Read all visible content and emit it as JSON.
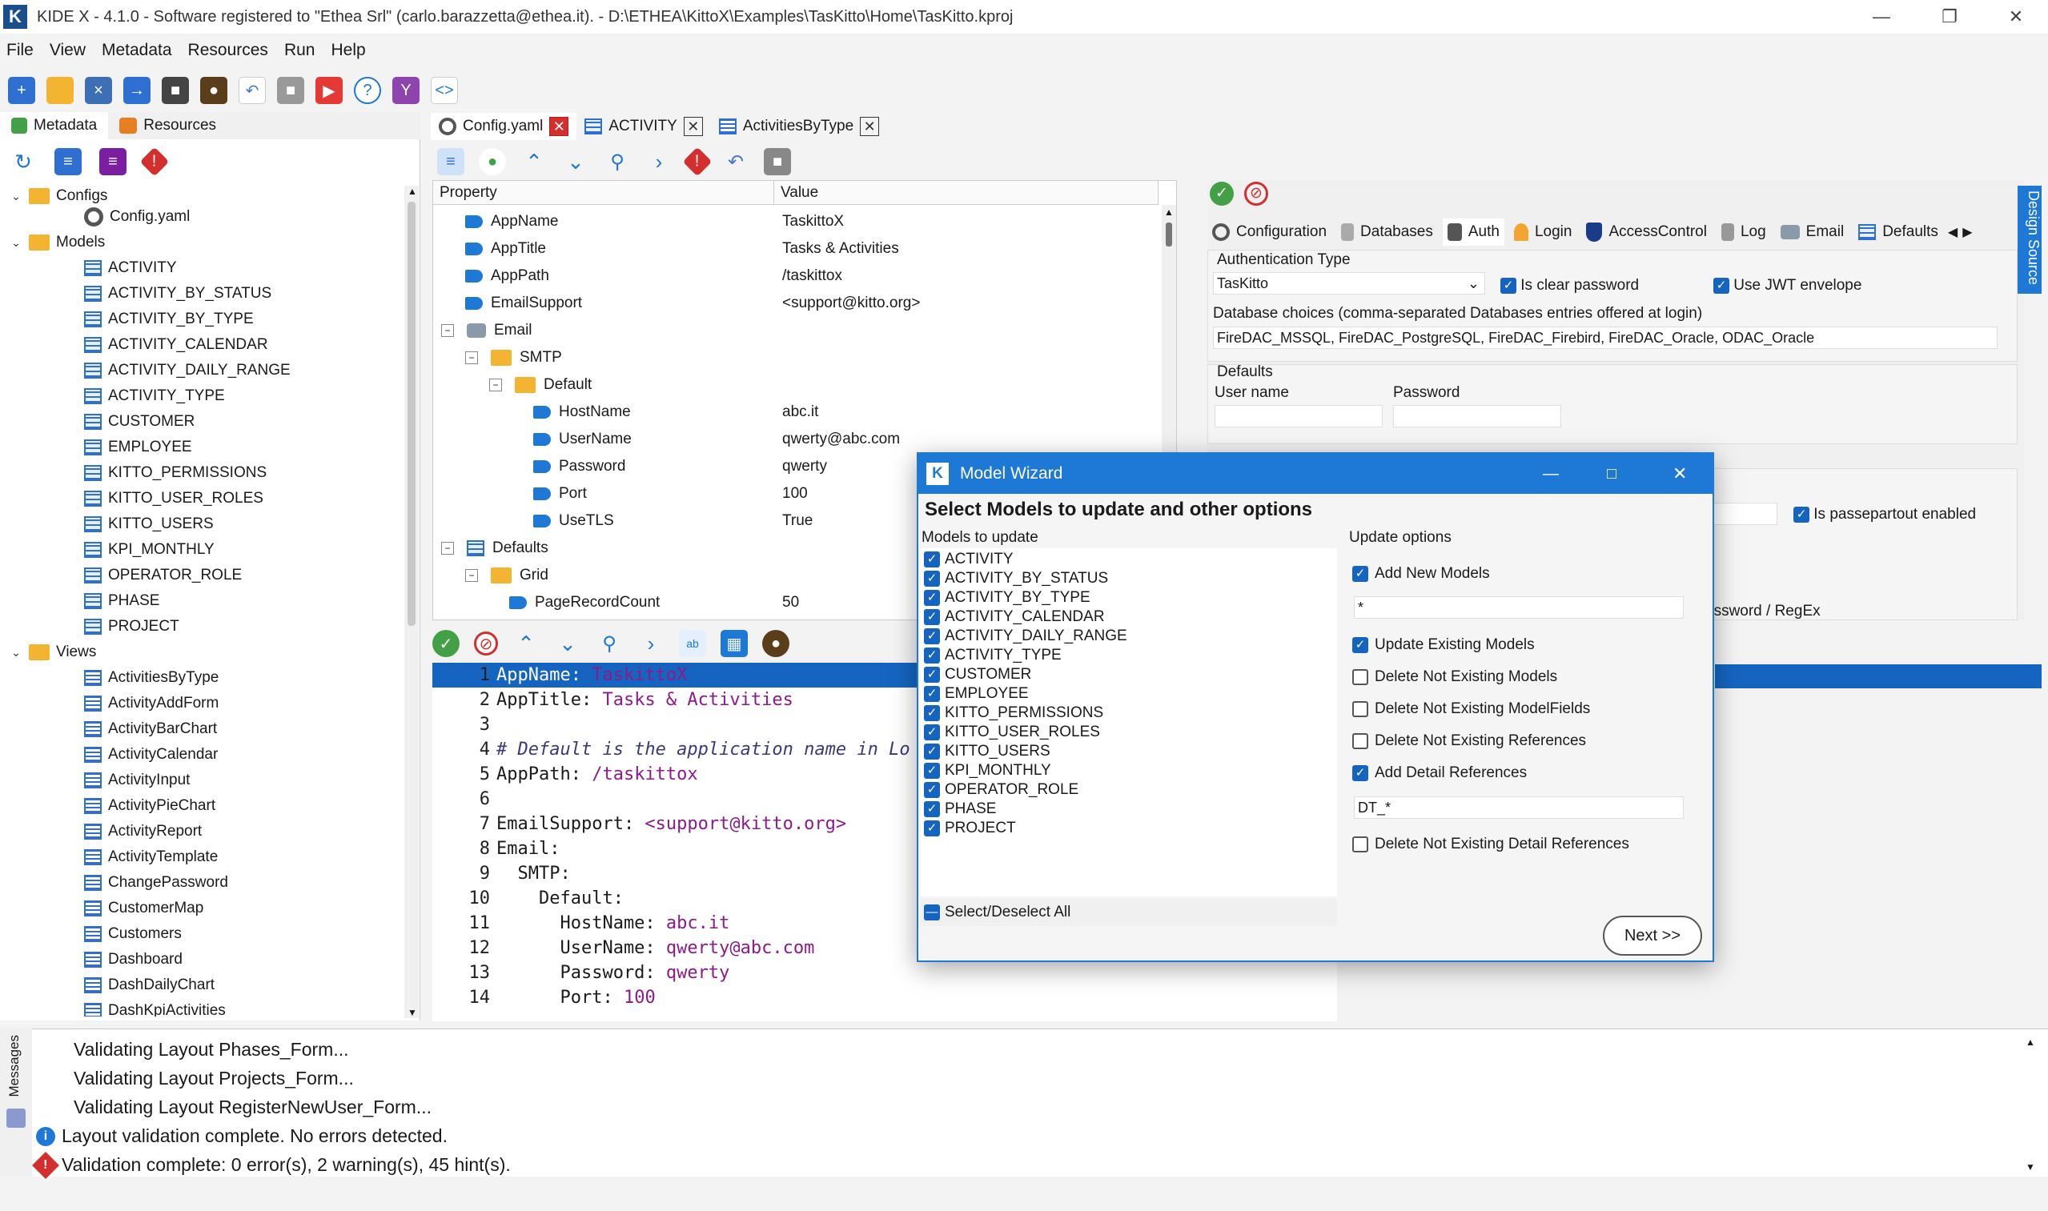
{
  "window": {
    "title": "KIDE X - 4.1.0 - Software registered to \"Ethea Srl\" (carlo.barazzetta@ethea.it). - D:\\ETHEA\\KittoX\\Examples\\TasKitto\\Home\\TasKitto.kproj",
    "logo": "K"
  },
  "menu": [
    "File",
    "View",
    "Metadata",
    "Resources",
    "Run",
    "Help"
  ],
  "left_tabs": {
    "metadata": "Metadata",
    "resources": "Resources"
  },
  "tree": {
    "configs_label": "Configs",
    "config_file": "Config.yaml",
    "models_label": "Models",
    "models": [
      "ACTIVITY",
      "ACTIVITY_BY_STATUS",
      "ACTIVITY_BY_TYPE",
      "ACTIVITY_CALENDAR",
      "ACTIVITY_DAILY_RANGE",
      "ACTIVITY_TYPE",
      "CUSTOMER",
      "EMPLOYEE",
      "KITTO_PERMISSIONS",
      "KITTO_USER_ROLES",
      "KITTO_USERS",
      "KPI_MONTHLY",
      "OPERATOR_ROLE",
      "PHASE",
      "PROJECT"
    ],
    "views_label": "Views",
    "views": [
      "ActivitiesByType",
      "ActivityAddForm",
      "ActivityBarChart",
      "ActivityCalendar",
      "ActivityInput",
      "ActivityPieChart",
      "ActivityReport",
      "ActivityTemplate",
      "ChangePassword",
      "CustomerMap",
      "Customers",
      "Dashboard",
      "DashDailyChart",
      "DashKpiActivities"
    ]
  },
  "doc_tabs": [
    "Config.yaml",
    "ACTIVITY",
    "ActivitiesByType"
  ],
  "propgrid": {
    "col_property": "Property",
    "col_value": "Value",
    "rows": [
      {
        "name": "AppName",
        "value": "TaskittoX"
      },
      {
        "name": "AppTitle",
        "value": "Tasks & Activities"
      },
      {
        "name": "AppPath",
        "value": "/taskittox"
      },
      {
        "name": "EmailSupport",
        "value": "<support@kitto.org>"
      },
      {
        "name": "Email",
        "value": ""
      },
      {
        "name": "SMTP",
        "value": ""
      },
      {
        "name": "Default",
        "value": ""
      },
      {
        "name": "HostName",
        "value": "abc.it"
      },
      {
        "name": "UserName",
        "value": "qwerty@abc.com"
      },
      {
        "name": "Password",
        "value": "qwerty"
      },
      {
        "name": "Port",
        "value": "100"
      },
      {
        "name": "UseTLS",
        "value": "True"
      },
      {
        "name": "Defaults",
        "value": ""
      },
      {
        "name": "Grid",
        "value": ""
      },
      {
        "name": "PageRecordCount",
        "value": "50"
      }
    ]
  },
  "editor": {
    "lines": [
      {
        "n": "1",
        "k": "AppName:",
        "v": " TaskittoX",
        "c": ""
      },
      {
        "n": "2",
        "k": "AppTitle:",
        "v": " Tasks & Activities",
        "c": ""
      },
      {
        "n": "3",
        "k": "",
        "v": "",
        "c": ""
      },
      {
        "n": "4",
        "k": "",
        "v": "",
        "c": "# Default is the application name in Lo"
      },
      {
        "n": "5",
        "k": "AppPath:",
        "v": " /taskittox",
        "c": ""
      },
      {
        "n": "6",
        "k": "",
        "v": "",
        "c": ""
      },
      {
        "n": "7",
        "k": "EmailSupport:",
        "v": " <support@kitto.org>",
        "c": ""
      },
      {
        "n": "8",
        "k": "Email:",
        "v": "",
        "c": ""
      },
      {
        "n": "9",
        "k": "  SMTP:",
        "v": "",
        "c": ""
      },
      {
        "n": "10",
        "k": "    Default:",
        "v": "",
        "c": ""
      },
      {
        "n": "11",
        "k": "      HostName:",
        "v": " abc.it",
        "c": ""
      },
      {
        "n": "12",
        "k": "      UserName:",
        "v": " qwerty@abc.com",
        "c": ""
      },
      {
        "n": "13",
        "k": "      Password:",
        "v": " qwerty",
        "c": ""
      },
      {
        "n": "14",
        "k": "      Port:",
        "v": " 100",
        "c": ""
      }
    ]
  },
  "right": {
    "tabs": [
      "Configuration",
      "Databases",
      "Auth",
      "Login",
      "AccessControl",
      "Log",
      "Email",
      "Defaults"
    ],
    "auth_type_label": "Authentication Type",
    "auth_type_value": "TasKitto",
    "is_clear_password": "Is clear password",
    "use_jwt": "Use JWT envelope",
    "db_choices_label": "Database choices (comma-separated Databases entries offered at login)",
    "db_choices_value": "FireDAC_MSSQL, FireDAC_PostgreSQL, FireDAC_Firebird, FireDAC_Oracle, ODAC_Oracle",
    "defaults_label": "Defaults",
    "user_name_label": "User name",
    "password_label": "Password",
    "passepartout": "Is passepartout enabled",
    "password_regex": "assword / RegEx",
    "side_tab": "Design Source"
  },
  "dialog": {
    "title": "Model Wizard",
    "heading": "Select Models to update and other options",
    "models_label": "Models to update",
    "models": [
      "ACTIVITY",
      "ACTIVITY_BY_STATUS",
      "ACTIVITY_BY_TYPE",
      "ACTIVITY_CALENDAR",
      "ACTIVITY_DAILY_RANGE",
      "ACTIVITY_TYPE",
      "CUSTOMER",
      "EMPLOYEE",
      "KITTO_PERMISSIONS",
      "KITTO_USER_ROLES",
      "KITTO_USERS",
      "KPI_MONTHLY",
      "OPERATOR_ROLE",
      "PHASE",
      "PROJECT"
    ],
    "select_all": "Select/Deselect All",
    "options_label": "Update options",
    "add_new_models": "Add New Models",
    "add_new_models_filter": "*",
    "update_existing": "Update Existing Models",
    "delete_models": "Delete Not Existing Models",
    "delete_fields": "Delete Not Existing ModelFields",
    "delete_refs": "Delete Not Existing References",
    "add_detail": "Add Detail References",
    "add_detail_filter": "DT_*",
    "delete_detail": "Delete Not Existing Detail References",
    "next": "Next >>"
  },
  "messages": {
    "side_label": "Messages",
    "lines": [
      "Validating Layout Phases_Form...",
      "Validating Layout Projects_Form...",
      "Validating Layout RegisterNewUser_Form...",
      "Layout validation complete. No errors detected.",
      "Validation complete: 0 error(s), 2 warning(s), 45 hint(s)."
    ]
  },
  "colors": {
    "accent": "#1e78d6",
    "folder": "#f3b531",
    "error": "#d32f2f",
    "success": "#43a047",
    "value_text": "#8b1a8b"
  }
}
